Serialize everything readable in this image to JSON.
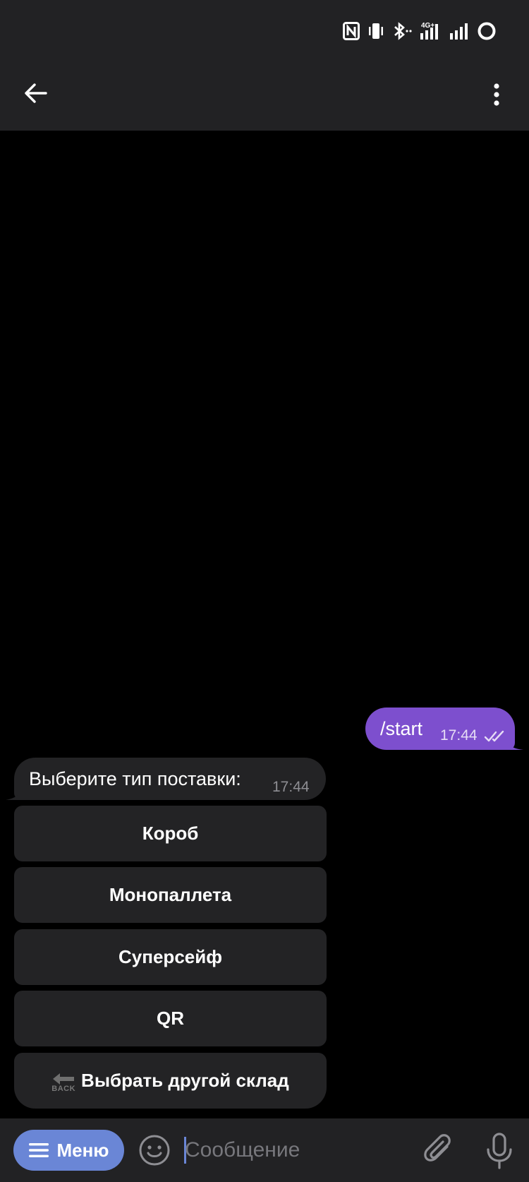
{
  "status_bar": {
    "icons": [
      "nfc-icon",
      "vibrate-icon",
      "bluetooth-icon",
      "signal-4g-icon",
      "signal-icon",
      "battery-icon"
    ],
    "network_label": "4G+"
  },
  "header": {
    "back_icon": "arrow-left-icon",
    "menu_icon": "more-vertical-icon"
  },
  "messages": [
    {
      "direction": "outgoing",
      "text": "/start",
      "time": "17:44",
      "status_icon": "double-check-icon"
    },
    {
      "direction": "incoming",
      "text": "Выберите тип поставки:",
      "time": "17:44"
    }
  ],
  "inline_keyboard": [
    {
      "label": "Короб"
    },
    {
      "label": "Монопаллета"
    },
    {
      "label": "Суперсейф"
    },
    {
      "label": "QR"
    },
    {
      "label": "Выбрать другой склад",
      "emoji_label": "BACK",
      "emoji_icon": "back-arrow-emoji-icon"
    }
  ],
  "input_bar": {
    "menu_label": "Меню",
    "placeholder": "Сообщение",
    "value": ""
  },
  "colors": {
    "accent": "#6a86d6",
    "outgoing_bubble": "#7d4fce",
    "incoming_bubble": "#232325",
    "bar_background": "#222224",
    "chat_background": "#000000"
  }
}
